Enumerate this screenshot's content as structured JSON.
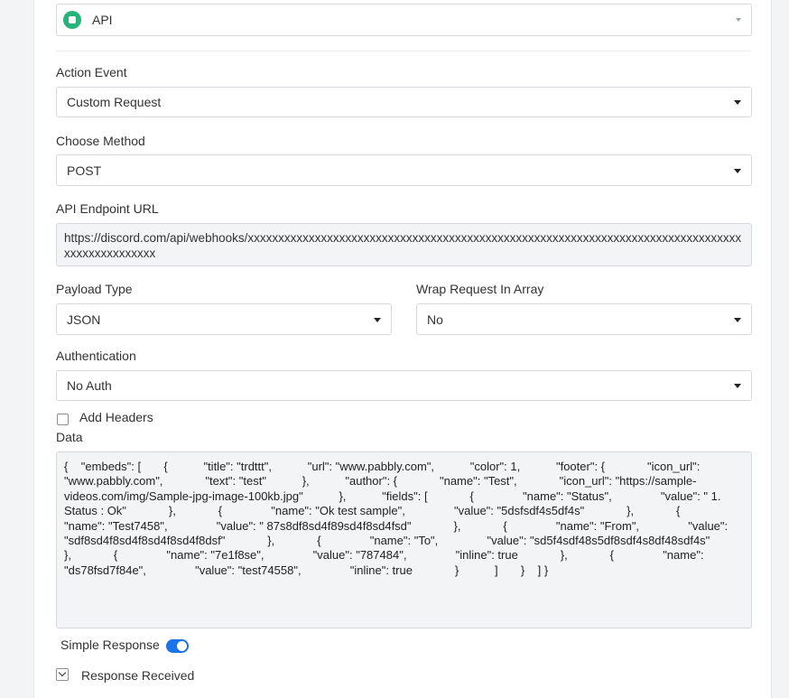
{
  "app_select": {
    "value": "API",
    "icon": "api-app-icon",
    "accent": "#27b47a"
  },
  "action_event": {
    "label": "Action Event",
    "value": "Custom Request"
  },
  "choose_method": {
    "label": "Choose Method",
    "value": "POST"
  },
  "endpoint": {
    "label": "API Endpoint URL",
    "value": "https://discord.com/api/webhooks/xxxxxxxxxxxxxxxxxxxxxxxxxxxxxxxxxxxxxxxxxxxxxxxxxxxxxxxxxxxxxxxxxxxxxxxxxxxxxxxxxxxxxxxxxxxxxxxx"
  },
  "payload_type": {
    "label": "Payload Type",
    "value": "JSON"
  },
  "wrap_request": {
    "label": "Wrap Request In Array",
    "value": "No"
  },
  "authentication": {
    "label": "Authentication",
    "value": "No Auth"
  },
  "add_headers": {
    "label": "Add Headers",
    "checked": false
  },
  "data": {
    "label": "Data",
    "value": "{    \"embeds\": [       {           \"title\": \"trdttt\",           \"url\": \"www.pabbly.com\",           \"color\": 1,           \"footer\": {             \"icon_url\": \"www.pabbly.com\",             \"text\": \"test\"           },           \"author\": {             \"name\": \"Test\",             \"icon_url\": \"https://sample-videos.com/img/Sample-jpg-image-100kb.jpg\"           },           \"fields\": [             {               \"name\": \"Status\",               \"value\": \" 1. Status : Ok\"             },             {               \"name\": \"Ok test sample\",               \"value\": \"5dsfsdf4s5df4s\"             },             {               \"name\": \"Test7458\",               \"value\": \" 87s8df8sd4f89sd4f8sd4fsd\"             },             {               \"name\": \"From\",               \"value\": \"sdf8sd4f8sd4f8sd4f8sd4f8dsf\"             },             {               \"name\": \"To\",               \"value\": \"sd5f4sdf48s5df8sdf4s8df48sdf4s\"             },             {               \"name\": \"7e1f8se\",               \"value\": \"787484\",               \"inline\": true             },             {               \"name\": \"ds78fsd7f84e\",               \"value\": \"test74558\",               \"inline\": true             }           ]       }    ] }"
  },
  "simple_response": {
    "label": "Simple Response",
    "on": true,
    "color": "#1a73e8"
  },
  "response_received": {
    "label": "Response Received"
  }
}
